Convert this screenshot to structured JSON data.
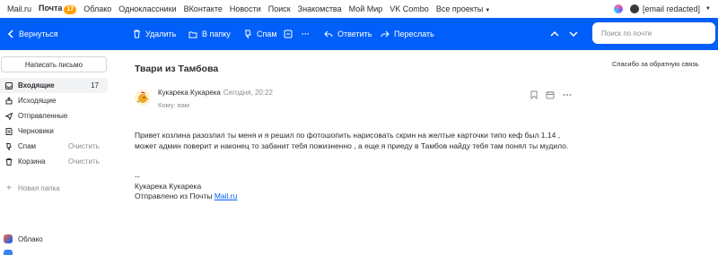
{
  "portal": {
    "links": [
      {
        "label": "Mail.ru"
      },
      {
        "label": "Почта",
        "badge": "17",
        "active": true
      },
      {
        "label": "Облако"
      },
      {
        "label": "Одноклассники"
      },
      {
        "label": "ВКонтакте"
      },
      {
        "label": "Новости"
      },
      {
        "label": "Поиск"
      },
      {
        "label": "Знакомства"
      },
      {
        "label": "Мой Мир"
      },
      {
        "label": "VK Combo"
      },
      {
        "label": "Все проекты"
      }
    ],
    "account_email": "[email redacted]"
  },
  "toolbar": {
    "back": "Вернуться",
    "delete": "Удалить",
    "to_folder": "В папку",
    "spam": "Спам",
    "more": "···",
    "reply": "Ответить",
    "forward": "Переслать",
    "search_placeholder": "Поиск по почте"
  },
  "sidebar": {
    "compose": "Написать письмо",
    "folders": [
      {
        "label": "Входящие",
        "count": "17",
        "icon": "inbox-icon"
      },
      {
        "label": "Исходящие",
        "icon": "outbox-icon"
      },
      {
        "label": "Отправленные",
        "icon": "sent-icon"
      },
      {
        "label": "Черновики",
        "icon": "drafts-icon"
      },
      {
        "label": "Спам",
        "clear": "Очистить",
        "icon": "spam-icon"
      },
      {
        "label": "Корзина",
        "clear": "Очистить",
        "icon": "trash-icon"
      }
    ],
    "new_folder": "Новая папка",
    "cloud": "Облако"
  },
  "message": {
    "subject": "Твари из Тамбова",
    "feedback": "Спасибо за обратную связь",
    "sender": "Кукарека Кукарека",
    "date": "Сегодня, 20:22",
    "to": "Кому: вам",
    "body": "Привет козлина разозлил ты меня и я решил по фотошопить  нарисовать скрин на желтые карточки типо кеф был 1.14  ,  может админ поверит и наконец то забанит тебя пожизненно , а еще я приеду в Тамбов найду тебя там понял ты мудило.",
    "sig_dash": "--",
    "sig_name": "Кукарека Кукарека",
    "sig_sent_from": "Отправлено из Почты ",
    "sig_link": "Mail.ru"
  },
  "colors": {
    "accent": "#005ff9",
    "badge": "#ff9e00"
  }
}
